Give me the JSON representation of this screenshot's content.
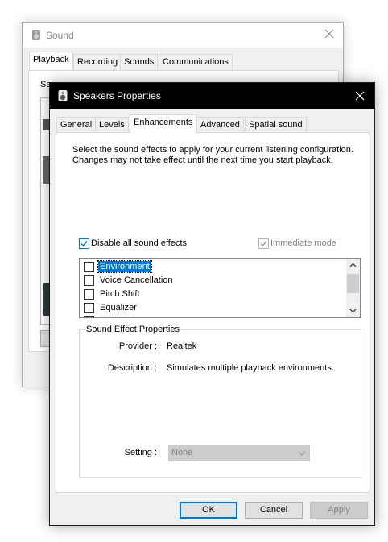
{
  "sound_window": {
    "title": "Sound",
    "tabs": [
      "Playback",
      "Recording",
      "Sounds",
      "Communications"
    ],
    "active_tab": "Playback",
    "panel_text": "Se"
  },
  "dialog": {
    "title": "Speakers Properties",
    "tabs": [
      "General",
      "Levels",
      "Enhancements",
      "Advanced",
      "Spatial sound"
    ],
    "active_tab": "Enhancements",
    "intro": "Select the sound effects to apply for your current listening configuration. Changes may not take effect until the next time you start playback.",
    "disable_all": {
      "label": "Disable all sound effects",
      "checked": true
    },
    "immediate_mode": {
      "label": "Immediate mode",
      "checked": true,
      "enabled": false
    },
    "effects": [
      {
        "label": "Environment",
        "checked": false,
        "selected": true
      },
      {
        "label": "Voice Cancellation",
        "checked": false,
        "selected": false
      },
      {
        "label": "Pitch Shift",
        "checked": false,
        "selected": false
      },
      {
        "label": "Equalizer",
        "checked": false,
        "selected": false
      }
    ],
    "props_group_title": "Sound Effect Properties",
    "provider_label": "Provider :",
    "provider_value": "Realtek",
    "description_label": "Description :",
    "description_value": "Simulates multiple playback environments.",
    "setting_label": "Setting :",
    "setting_value": "None",
    "buttons": {
      "ok": "OK",
      "cancel": "Cancel",
      "apply": "Apply"
    }
  },
  "colors": {
    "accent": "#0078d7",
    "titlebar": "#000000"
  },
  "icons": [
    "speaker-icon",
    "close-icon",
    "checkmark-icon",
    "scroll-up-icon",
    "scroll-down-icon",
    "chevron-down-icon"
  ]
}
